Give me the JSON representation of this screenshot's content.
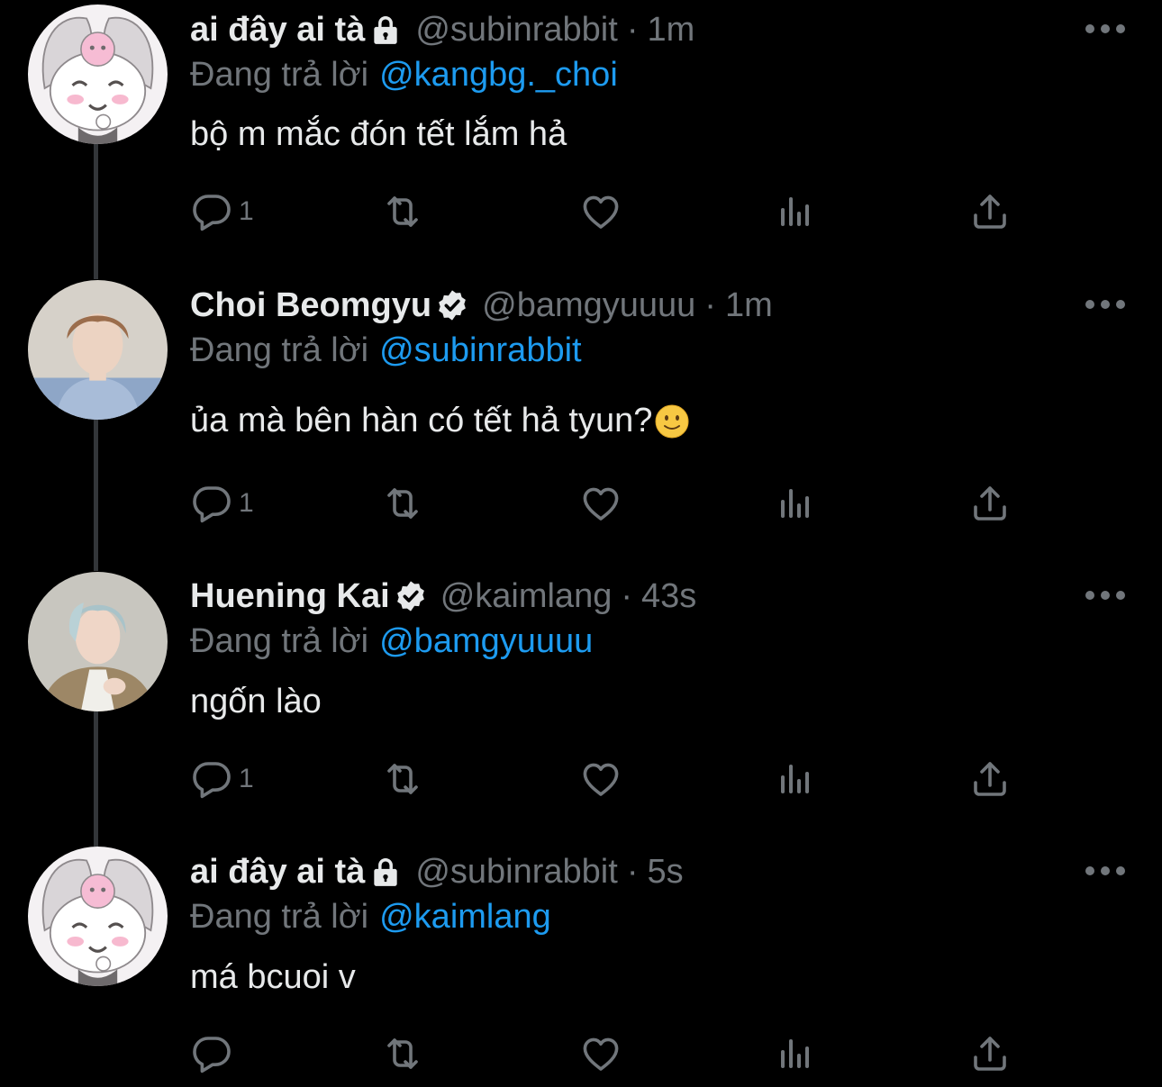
{
  "colors": {
    "background": "#000000",
    "primary_text": "#e7e9ea",
    "secondary_text": "#71767b",
    "link": "#1d9bf0",
    "thread_line": "#333639"
  },
  "tweets": [
    {
      "display_name": "ai đây ai tà",
      "badge": "lock-icon",
      "handle": "@subinrabbit",
      "separator": "·",
      "time": "1m",
      "reply_label": "Đang trả lời",
      "reply_to": "@kangbg._choi",
      "text": "bộ m mắc đón tết lắm hả",
      "reply_count": "1",
      "avatar": "cartoon-bunny-avatar"
    },
    {
      "display_name": "Choi Beomgyu",
      "badge": "verified-icon",
      "handle": "@bamgyuuuu",
      "separator": "·",
      "time": "1m",
      "reply_label": "Đang trả lời",
      "reply_to": "@subinrabbit",
      "text": "ủa mà bên hàn có tết hả tyun?",
      "emoji": "slightly-smiling-face",
      "reply_count": "1",
      "avatar": "profile-photo"
    },
    {
      "display_name": "Huening Kai",
      "badge": "verified-icon",
      "handle": "@kaimlang",
      "separator": "·",
      "time": "43s",
      "reply_label": "Đang trả lời",
      "reply_to": "@bamgyuuuu",
      "text": "ngốn lào",
      "reply_count": "1",
      "avatar": "profile-photo"
    },
    {
      "display_name": "ai đây ai tà",
      "badge": "lock-icon",
      "handle": "@subinrabbit",
      "separator": "·",
      "time": "5s",
      "reply_label": "Đang trả lời",
      "reply_to": "@kaimlang",
      "text": "má bcuoi v",
      "reply_count": "",
      "avatar": "cartoon-bunny-avatar"
    }
  ]
}
